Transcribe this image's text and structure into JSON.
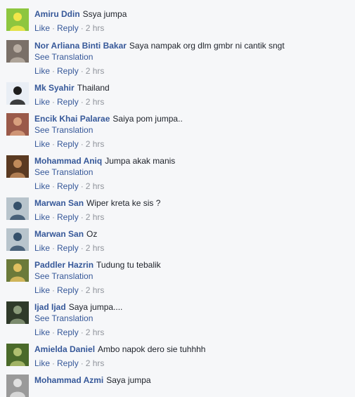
{
  "common": {
    "like": "Like",
    "reply": "Reply",
    "see_translation": "See Translation",
    "dot": "·"
  },
  "comments": [
    {
      "author": "Amiru Ddin",
      "text": "Ssya jumpa",
      "time": "2 hrs",
      "translation": false,
      "avatar": {
        "name": "green-cartoon-avatar",
        "bg": "#8dc63f",
        "fg": "#f2e64a"
      }
    },
    {
      "author": "Nor Arliana Binti Bakar",
      "text": "Saya nampak org dlm gmbr ni cantik sngt",
      "time": "2 hrs",
      "translation": true,
      "avatar": {
        "name": "photo-avatar",
        "bg": "#7a7068",
        "fg": "#b9aea3"
      }
    },
    {
      "author": "Mk Syahir",
      "text": "Thailand",
      "time": "2 hrs",
      "translation": false,
      "avatar": {
        "name": "anime-avatar",
        "bg": "#e9eef5",
        "fg": "#1d1d1d"
      }
    },
    {
      "author": "Encik Khai Palarae",
      "text": "Saiya pom jumpa..",
      "time": "2 hrs",
      "translation": true,
      "avatar": {
        "name": "couple-photo-avatar",
        "bg": "#9a5a4a",
        "fg": "#d8a07e"
      }
    },
    {
      "author": "Mohammad Aniq",
      "text": "Jumpa akak manis",
      "time": "2 hrs",
      "translation": true,
      "avatar": {
        "name": "portrait-avatar",
        "bg": "#5a3a22",
        "fg": "#c08a5a"
      }
    },
    {
      "author": "Marwan San",
      "text": "Wiper kreta ke sis ?",
      "time": "2 hrs",
      "translation": false,
      "avatar": {
        "name": "outdoor-photo-avatar",
        "bg": "#b8c4cc",
        "fg": "#35506a"
      }
    },
    {
      "author": "Marwan San",
      "text": "Oz",
      "time": "2 hrs",
      "translation": false,
      "avatar": {
        "name": "outdoor-photo-avatar",
        "bg": "#b8c4cc",
        "fg": "#35506a"
      }
    },
    {
      "author": "Paddler Hazrin",
      "text": "Tudung tu tebalik",
      "time": "2 hrs",
      "translation": true,
      "avatar": {
        "name": "group-photo-avatar",
        "bg": "#6b7a3a",
        "fg": "#e0c060"
      }
    },
    {
      "author": "Ijad Ijad",
      "text": "Saya jumpa....",
      "time": "2 hrs",
      "translation": true,
      "avatar": {
        "name": "dark-photo-avatar",
        "bg": "#2f3a2a",
        "fg": "#8a9a7a"
      }
    },
    {
      "author": "Amielda Daniel",
      "text": "Ambo napok dero sie tuhhhh",
      "time": "2 hrs",
      "translation": false,
      "avatar": {
        "name": "nature-photo-avatar",
        "bg": "#4a6a2a",
        "fg": "#b0c070"
      }
    },
    {
      "author": "Mohammad Azmi",
      "text": "Saya jumpa",
      "time": "",
      "translation": false,
      "avatar": {
        "name": "bw-photo-avatar",
        "bg": "#9a9a9a",
        "fg": "#e0e0e0"
      }
    }
  ]
}
